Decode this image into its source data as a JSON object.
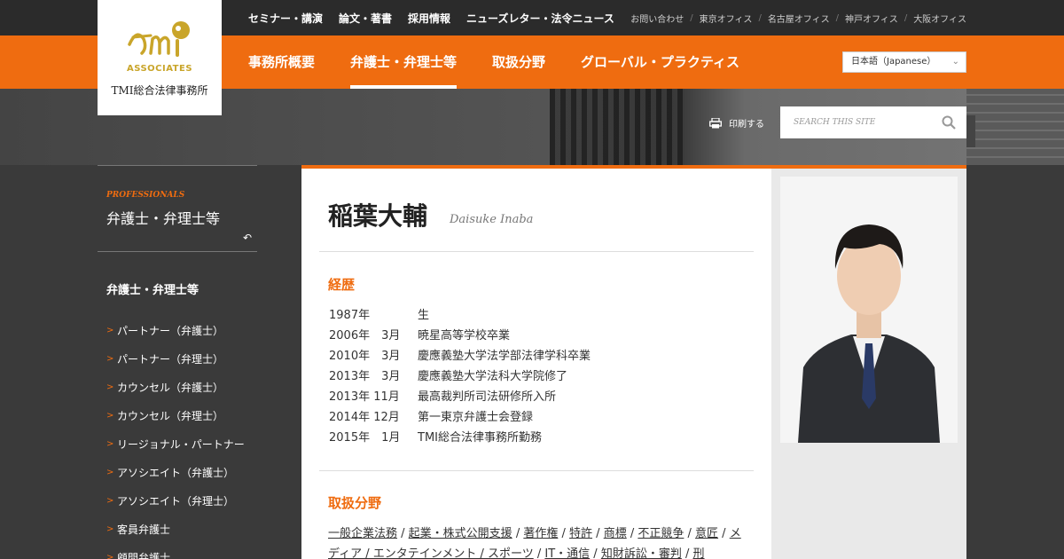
{
  "topnav": [
    "セミナー・講演",
    "論文・著書",
    "採用情報",
    "ニューズレター・法令ニュース"
  ],
  "offices": [
    "お問い合わせ",
    "東京オフィス",
    "名古屋オフィス",
    "神戸オフィス",
    "大阪オフィス"
  ],
  "mainnav": [
    "事務所概要",
    "弁護士・弁理士等",
    "取扱分野",
    "グローバル・プラクティス"
  ],
  "mainnav_active_index": 1,
  "language": "日本語（Japanese）",
  "logo": {
    "mark": "tmi",
    "assoc": "ASSOCIATES",
    "firm": "TMI総合法律事務所"
  },
  "print_label": "印刷する",
  "search": {
    "placeholder": "SEARCH THIS SITE"
  },
  "sidebar": {
    "label": "PROFESSIONALS",
    "title": "弁護士・弁理士等",
    "sub": "弁護士・弁理士等",
    "items": [
      "パートナー（弁護士）",
      "パートナー（弁理士）",
      "カウンセル（弁護士）",
      "カウンセル（弁理士）",
      "リージョナル・パートナー",
      "アソシエイト（弁護士）",
      "アソシエイト（弁理士）",
      "客員弁護士",
      "顧問弁護士"
    ]
  },
  "profile": {
    "name": "稲葉大輔",
    "name_en": "Daisuke Inaba",
    "career_heading": "経歴",
    "career": [
      {
        "date": "1987年",
        "text": "生"
      },
      {
        "date": "2006年　3月",
        "text": "暁星高等学校卒業"
      },
      {
        "date": "2010年　3月",
        "text": "慶應義塾大学法学部法律学科卒業"
      },
      {
        "date": "2013年　3月",
        "text": "慶應義塾大学法科大学院修了"
      },
      {
        "date": "2013年 11月",
        "text": "最高裁判所司法研修所入所"
      },
      {
        "date": "2014年 12月",
        "text": "第一東京弁護士会登録"
      },
      {
        "date": "2015年　1月",
        "text": "TMI総合法律事務所勤務"
      }
    ],
    "areas_heading": "取扱分野",
    "areas": [
      "一般企業法務",
      "起業・株式公開支援",
      "著作権",
      "特許",
      "商標",
      "不正競争",
      "意匠",
      "メディア / エンタテインメント / スポーツ",
      "IT・通信",
      "知財訴訟・審判",
      "刑"
    ]
  },
  "colors": {
    "accent": "#ef6c10",
    "dark": "#2b2b2b"
  }
}
